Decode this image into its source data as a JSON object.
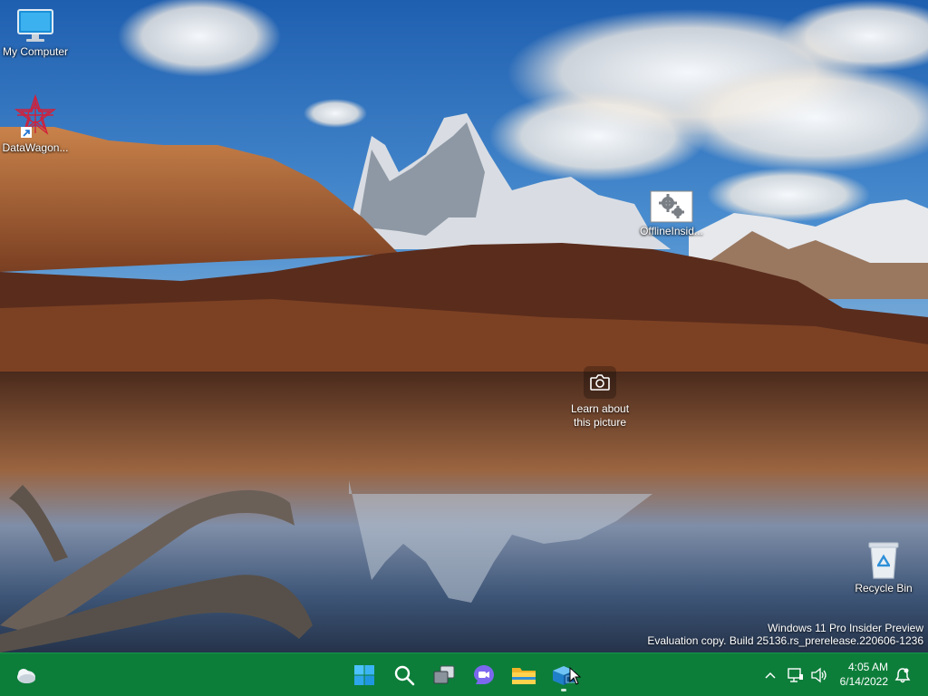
{
  "desktop": {
    "icons": [
      {
        "label": "My Computer",
        "icon": "monitor-icon"
      },
      {
        "label": "DataWagon...",
        "icon": "datawagon-shortcut-icon"
      },
      {
        "label": "OfflineInsid...",
        "icon": "settings-gears-file-icon"
      },
      {
        "label": "Recycle Bin",
        "icon": "recycle-bin-icon"
      }
    ],
    "learn_picture": {
      "line1": "Learn about",
      "line2": "this picture",
      "icon": "camera-icon"
    },
    "watermark": {
      "line1": "Windows 11 Pro Insider Preview",
      "line2": "Evaluation copy. Build 25136.rs_prerelease.220606-1236"
    }
  },
  "taskbar": {
    "background": "#0d7e3a",
    "widgets": {
      "icon": "weather-cloud-icon"
    },
    "apps": [
      {
        "name": "Start",
        "icon": "windows-start-icon"
      },
      {
        "name": "Search",
        "icon": "search-icon"
      },
      {
        "name": "Task View",
        "icon": "task-view-icon"
      },
      {
        "name": "Chat",
        "icon": "chat-camera-icon"
      },
      {
        "name": "File Explorer",
        "icon": "folder-icon"
      },
      {
        "name": "Virtual Box",
        "icon": "box-app-icon"
      }
    ],
    "tray": {
      "chevron": "chevron-up-icon",
      "network": "network-icon",
      "volume": "volume-icon",
      "time": "4:05 AM",
      "date": "6/14/2022",
      "notifications": "notification-bell-icon"
    }
  }
}
